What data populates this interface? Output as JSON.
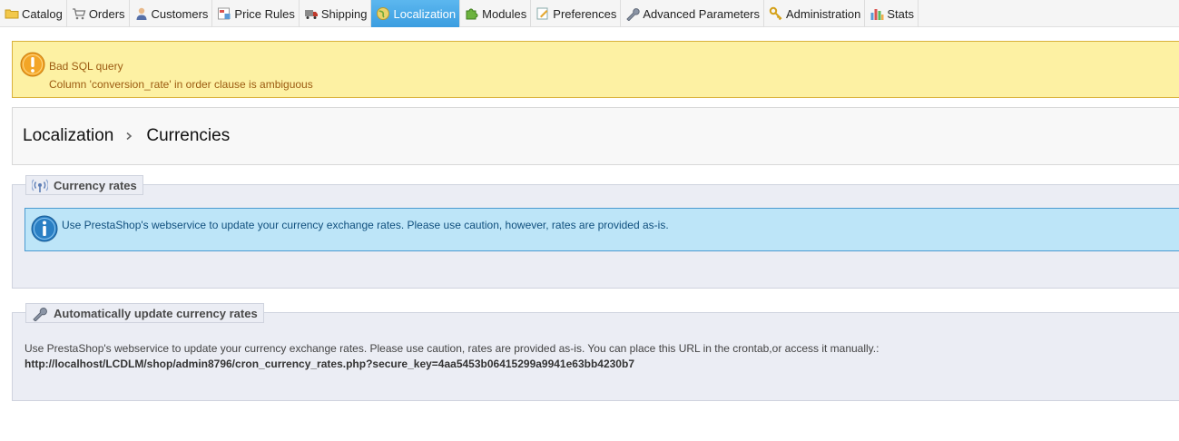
{
  "nav": {
    "tabs": [
      {
        "label": "Catalog",
        "icon": "folder-icon"
      },
      {
        "label": "Orders",
        "icon": "cart-icon"
      },
      {
        "label": "Customers",
        "icon": "user-icon"
      },
      {
        "label": "Price Rules",
        "icon": "price-tag-icon"
      },
      {
        "label": "Shipping",
        "icon": "truck-icon"
      },
      {
        "label": "Localization",
        "icon": "globe-icon",
        "active": true
      },
      {
        "label": "Modules",
        "icon": "puzzle-icon"
      },
      {
        "label": "Preferences",
        "icon": "preferences-icon"
      },
      {
        "label": "Advanced Parameters",
        "icon": "wrench-icon"
      },
      {
        "label": "Administration",
        "icon": "key-icon"
      },
      {
        "label": "Stats",
        "icon": "bar-chart-icon"
      }
    ]
  },
  "warning": {
    "title": "Bad SQL query",
    "message": "Column 'conversion_rate' in order clause is ambiguous"
  },
  "breadcrumb": {
    "parent": "Localization",
    "current": "Currencies"
  },
  "currency_rates": {
    "legend": "Currency rates",
    "info": "Use PrestaShop's webservice to update your currency exchange rates. Please use caution, however, rates are provided as-is."
  },
  "auto_update": {
    "legend": "Automatically update currency rates",
    "description": "Use PrestaShop's webservice to update your currency exchange rates. Please use caution, rates are provided as-is. You can place this URL in the crontab,or access it manually.:",
    "cron_url": "http://localhost/LCDLM/shop/admin8796/cron_currency_rates.php?secure_key=4aa5453b06415299a9941e63bb4230b7"
  },
  "colors": {
    "active_tab": "#3a9de0",
    "warning_bg": "#fdf1a3",
    "info_bg": "#bde5f8",
    "fieldset_bg": "#ebedf4"
  }
}
